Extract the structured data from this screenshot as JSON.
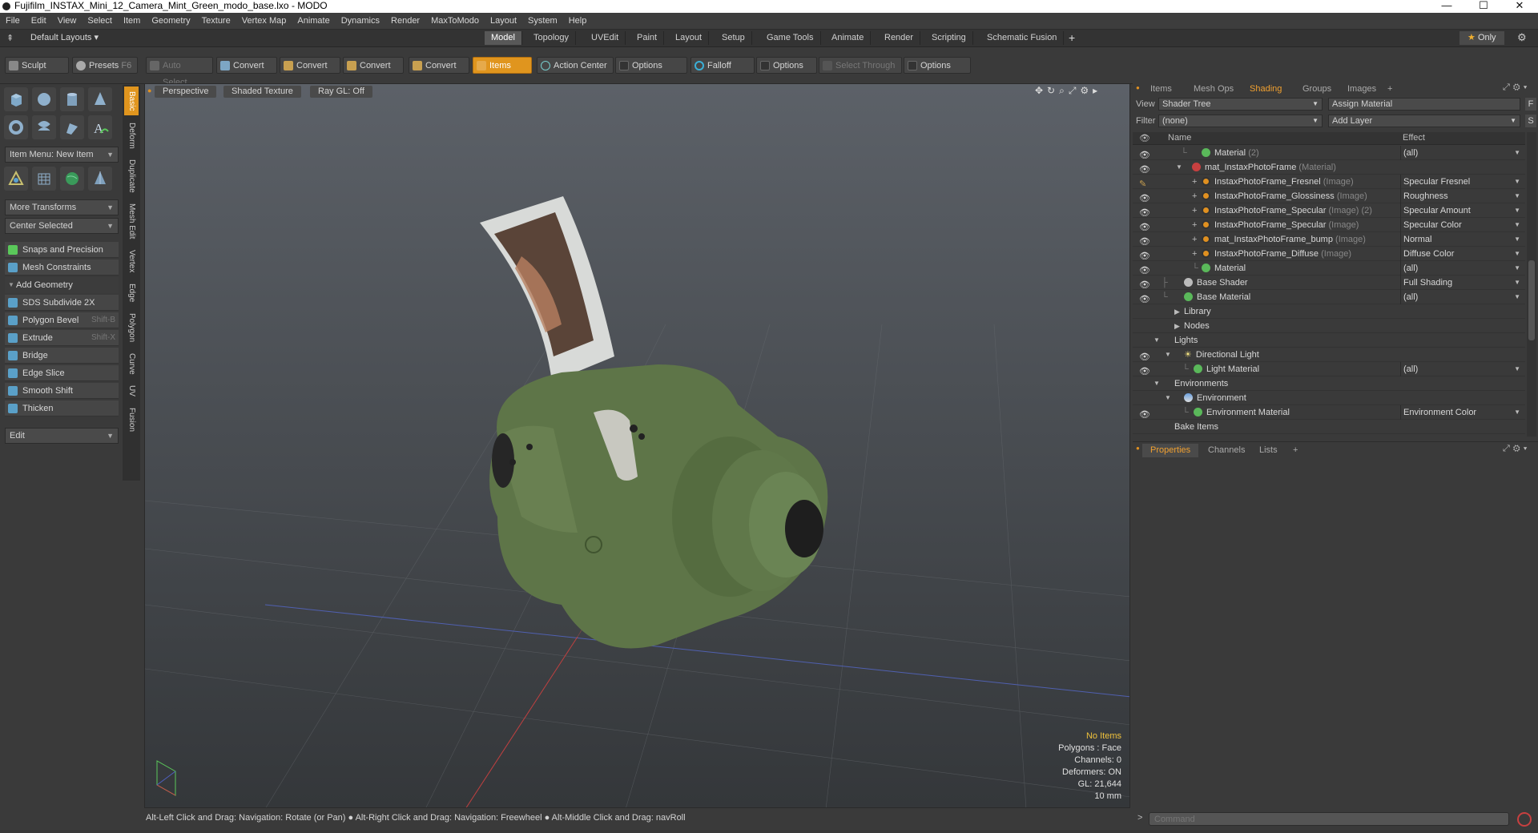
{
  "window": {
    "title": "Fujifilm_INSTAX_Mini_12_Camera_Mint_Green_modo_base.lxo - MODO",
    "minimize": "—",
    "maximize": "☐",
    "close": "✕"
  },
  "menu": [
    "File",
    "Edit",
    "View",
    "Select",
    "Item",
    "Geometry",
    "Texture",
    "Vertex Map",
    "Animate",
    "Dynamics",
    "Render",
    "MaxToModo",
    "Layout",
    "System",
    "Help"
  ],
  "layoutbar": {
    "layouts_label": "Default Layouts",
    "tabs": [
      "Model",
      "Topology",
      "UVEdit",
      "Paint",
      "Layout",
      "Setup",
      "Game Tools",
      "Animate",
      "Render",
      "Scripting",
      "Schematic Fusion"
    ],
    "active_tab": "Model",
    "add": "+",
    "only": "Only"
  },
  "toolbar": {
    "sculpt": "Sculpt",
    "presets": "Presets",
    "presets_key": "F6",
    "auto_select": "Auto Select",
    "convert1": "Convert",
    "convert2": "Convert",
    "convert3": "Convert",
    "convert4": "Convert",
    "items": "Items",
    "action_center": "Action Center",
    "options1": "Options",
    "falloff": "Falloff",
    "options2": "Options",
    "select_through": "Select Through",
    "options3": "Options"
  },
  "leftpanel": {
    "item_menu": "Item Menu: New Item",
    "more_transforms": "More Transforms",
    "center_selected": "Center Selected",
    "snaps": "Snaps and Precision",
    "mesh_constraints": "Mesh Constraints",
    "add_geometry": "Add Geometry",
    "tools": [
      {
        "label": "SDS Subdivide 2X",
        "shortcut": ""
      },
      {
        "label": "Polygon Bevel",
        "shortcut": "Shift-B"
      },
      {
        "label": "Extrude",
        "shortcut": "Shift-X"
      },
      {
        "label": "Bridge",
        "shortcut": ""
      },
      {
        "label": "Edge Slice",
        "shortcut": ""
      },
      {
        "label": "Smooth Shift",
        "shortcut": ""
      },
      {
        "label": "Thicken",
        "shortcut": ""
      }
    ],
    "edit": "Edit",
    "vtabs": [
      "Basic",
      "Deform",
      "Duplicate",
      "Mesh Edit",
      "Vertex",
      "Edge",
      "Polygon",
      "Curve",
      "UV",
      "Fusion"
    ]
  },
  "viewport": {
    "perspective": "Perspective",
    "shaded": "Shaded Texture",
    "raygl": "Ray GL: Off",
    "info": {
      "no_items": "No Items",
      "polygons": "Polygons : Face",
      "channels": "Channels: 0",
      "deformers": "Deformers: ON",
      "gl": "GL: 21,644",
      "scale": "10 mm"
    }
  },
  "status": "Alt-Left Click and Drag: Navigation: Rotate (or Pan) ● Alt-Right Click and Drag: Navigation: Freewheel ● Alt-Middle Click and Drag: navRoll",
  "rightpanel": {
    "tabs": [
      "Items",
      "Mesh Ops",
      "Shading",
      "Groups",
      "Images"
    ],
    "active_tab": "Shading",
    "add": "+",
    "view_label": "View",
    "view_value": "Shader Tree",
    "assign_material": "Assign Material",
    "f_btn": "F",
    "filter_label": "Filter",
    "filter_value": "(none)",
    "add_layer": "Add Layer",
    "s_btn": "S",
    "col_name": "Name",
    "col_effect": "Effect",
    "rows": [
      {
        "name": "Material",
        "type": "(2)",
        "effect": "(all)"
      },
      {
        "name": "mat_InstaxPhotoFrame",
        "type": "(Material)",
        "effect": ""
      },
      {
        "name": "InstaxPhotoFrame_Fresnel",
        "type": "(Image)",
        "effect": "Specular Fresnel"
      },
      {
        "name": "InstaxPhotoFrame_Glossiness",
        "type": "(Image)",
        "effect": "Roughness"
      },
      {
        "name": "InstaxPhotoFrame_Specular",
        "type": "(Image) (2)",
        "effect": "Specular Amount"
      },
      {
        "name": "InstaxPhotoFrame_Specular",
        "type": "(Image)",
        "effect": "Specular Color"
      },
      {
        "name": "mat_InstaxPhotoFrame_bump",
        "type": "(Image)",
        "effect": "Normal"
      },
      {
        "name": "InstaxPhotoFrame_Diffuse",
        "type": "(Image)",
        "effect": "Diffuse Color"
      },
      {
        "name": "Material",
        "type": "",
        "effect": "(all)"
      },
      {
        "name": "Base Shader",
        "type": "",
        "effect": "Full Shading"
      },
      {
        "name": "Base Material",
        "type": "",
        "effect": "(all)"
      },
      {
        "name": "Library",
        "type": "",
        "effect": ""
      },
      {
        "name": "Nodes",
        "type": "",
        "effect": ""
      },
      {
        "name": "Lights",
        "type": "",
        "effect": ""
      },
      {
        "name": "Directional Light",
        "type": "",
        "effect": ""
      },
      {
        "name": "Light Material",
        "type": "",
        "effect": "(all)"
      },
      {
        "name": "Environments",
        "type": "",
        "effect": ""
      },
      {
        "name": "Environment",
        "type": "",
        "effect": ""
      },
      {
        "name": "Environment Material",
        "type": "",
        "effect": "Environment Color"
      },
      {
        "name": "Bake Items",
        "type": "",
        "effect": ""
      }
    ],
    "props_tabs": [
      "Properties",
      "Channels",
      "Lists"
    ],
    "props_add": "+",
    "command_placeholder": "Command",
    "prompt": ">"
  },
  "colors": {
    "accent": "#e0951e",
    "mesh": "#5e7548"
  }
}
